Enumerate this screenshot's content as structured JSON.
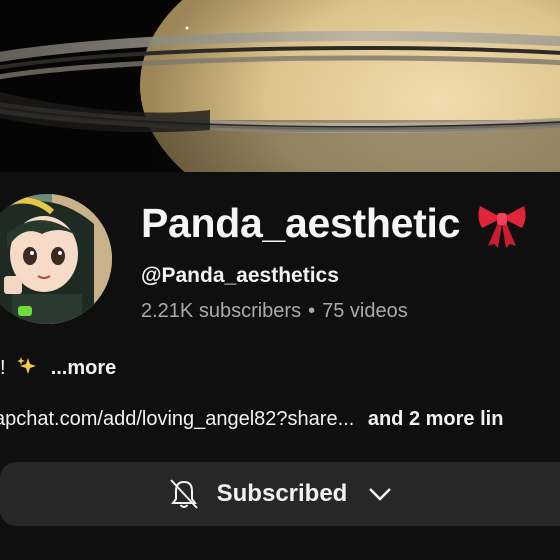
{
  "channel": {
    "name": "Panda_aesthetic",
    "handle": "@Panda_aesthetics",
    "subscribers": "2.21K subscribers",
    "separator": "•",
    "videos": "75 videos"
  },
  "description": {
    "leading": "!",
    "more_label": "...more"
  },
  "links": {
    "url_text": "apchat.com/add/loving_angel82?share...",
    "more_links_text": "and 2 more lin"
  },
  "subscribe_button": {
    "label": "Subscribed",
    "icons": [
      "bell-off-icon",
      "chevron-down-icon"
    ]
  },
  "colors": {
    "background": "#0f0f0f",
    "button_bg": "#272727",
    "secondary_text": "#aaaaaa"
  }
}
